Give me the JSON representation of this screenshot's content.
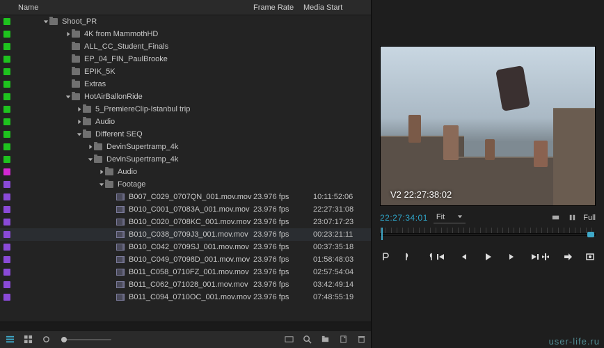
{
  "columns": {
    "name": "Name",
    "fps": "Frame Rate",
    "start": "Media Start"
  },
  "tree": [
    {
      "label": "Shoot_PR",
      "type": "folder",
      "indent": 60,
      "chip": "c-green",
      "arrow": "down"
    },
    {
      "label": "4K from MammothHD",
      "type": "folder",
      "indent": 92,
      "chip": "c-green",
      "arrow": "right"
    },
    {
      "label": "ALL_CC_Student_Finals",
      "type": "folder",
      "indent": 92,
      "chip": "c-green",
      "arrow": "none"
    },
    {
      "label": "EP_04_FIN_PaulBrooke",
      "type": "folder",
      "indent": 92,
      "chip": "c-green",
      "arrow": "none"
    },
    {
      "label": "EPIK_5K",
      "type": "folder",
      "indent": 92,
      "chip": "c-green",
      "arrow": "none"
    },
    {
      "label": "Extras",
      "type": "folder",
      "indent": 92,
      "chip": "c-green",
      "arrow": "none"
    },
    {
      "label": "HotAirBallonRide",
      "type": "folder",
      "indent": 92,
      "chip": "c-green",
      "arrow": "down"
    },
    {
      "label": "5_PremiereClip-Istanbul trip",
      "type": "folder",
      "indent": 108,
      "chip": "c-green",
      "arrow": "right"
    },
    {
      "label": "Audio",
      "type": "folder",
      "indent": 108,
      "chip": "c-green",
      "arrow": "right"
    },
    {
      "label": "Different SEQ",
      "type": "folder",
      "indent": 108,
      "chip": "c-green",
      "arrow": "down"
    },
    {
      "label": "DevinSupertramp_4k",
      "type": "folder",
      "indent": 124,
      "chip": "c-green",
      "arrow": "right"
    },
    {
      "label": "DevinSupertramp_4k",
      "type": "folder",
      "indent": 124,
      "chip": "c-green",
      "arrow": "down"
    },
    {
      "label": "Audio",
      "type": "folder",
      "indent": 140,
      "chip": "c-magenta",
      "arrow": "right"
    },
    {
      "label": "Footage",
      "type": "folder",
      "indent": 140,
      "chip": "c-purple",
      "arrow": "down"
    },
    {
      "label": "B007_C029_0707QN_001.mov.mov",
      "type": "clip",
      "indent": 156,
      "chip": "c-purple",
      "fps": "23.976 fps",
      "start": "10:11:52:06"
    },
    {
      "label": "B010_C001_07083A_001.mov.mov",
      "type": "clip",
      "indent": 156,
      "chip": "c-purple",
      "fps": "23.976 fps",
      "start": "22:27:31:08"
    },
    {
      "label": "B010_C020_0708KC_001.mov.mov",
      "type": "clip",
      "indent": 156,
      "chip": "c-purple",
      "fps": "23.976 fps",
      "start": "23:07:17:23"
    },
    {
      "label": "B010_C038_0709J3_001.mov.mov",
      "type": "clip",
      "indent": 156,
      "chip": "c-purple",
      "fps": "23.976 fps",
      "start": "00:23:21:11",
      "selected": true
    },
    {
      "label": "B010_C042_0709SJ_001.mov.mov",
      "type": "clip",
      "indent": 156,
      "chip": "c-purple",
      "fps": "23.976 fps",
      "start": "00:37:35:18"
    },
    {
      "label": "B010_C049_07098D_001.mov.mov",
      "type": "clip",
      "indent": 156,
      "chip": "c-purple",
      "fps": "23.976 fps",
      "start": "01:58:48:03"
    },
    {
      "label": "B011_C058_0710FZ_001.mov.mov",
      "type": "clip",
      "indent": 156,
      "chip": "c-purple",
      "fps": "23.976 fps",
      "start": "02:57:54:04"
    },
    {
      "label": "B011_C062_071028_001.mov.mov",
      "type": "clip",
      "indent": 156,
      "chip": "c-purple",
      "fps": "23.976 fps",
      "start": "03:42:49:14"
    },
    {
      "label": "B011_C094_0710OC_001.mov.mov",
      "type": "clip",
      "indent": 156,
      "chip": "c-purple",
      "fps": "23.976 fps",
      "start": "07:48:55:19"
    }
  ],
  "monitor": {
    "overlay": "V2 22:27:38:02",
    "timecode": "22:27:34:01",
    "fit": "Fit",
    "quality": "Full"
  },
  "watermark": "user-life.ru"
}
